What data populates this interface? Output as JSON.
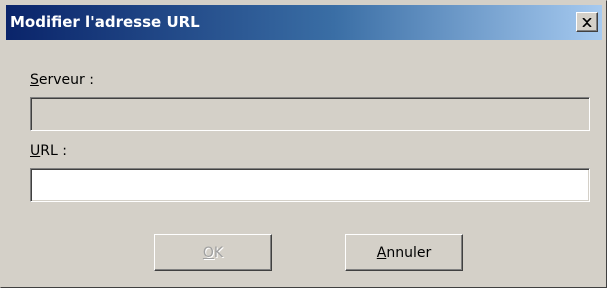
{
  "window": {
    "title": "Modifier l'adresse URL",
    "close_label": "Fermer"
  },
  "form": {
    "server_label_mnemonic": "S",
    "server_label_rest": "erveur :",
    "server_value": "",
    "url_label_mnemonic": "U",
    "url_label_rest": "RL :",
    "url_value": ""
  },
  "buttons": {
    "ok_mnemonic": "O",
    "ok_rest": "K",
    "ok_enabled": false,
    "cancel_mnemonic": "A",
    "cancel_rest": "nnuler",
    "cancel_enabled": true
  },
  "colors": {
    "dialog_bg": "#d4d0c8",
    "title_gradient_start": "#0a246a",
    "title_gradient_end": "#a6caf0",
    "disabled_text": "#a0a0a0"
  },
  "icons": {
    "close": "close-icon"
  }
}
